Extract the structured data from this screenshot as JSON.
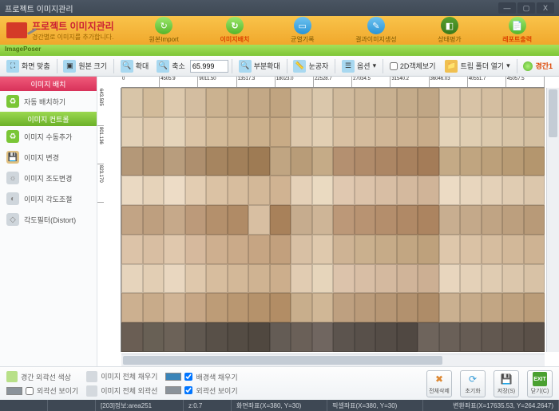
{
  "window": {
    "title": "프로젝트 이미지관리",
    "buttons": {
      "min": "—",
      "max": "▢",
      "close": "X"
    }
  },
  "header": {
    "title": "프로젝트 이미지관리",
    "subtitle": "경간별로 이미지를 추가합니다.",
    "steps": [
      {
        "label": "원본Import"
      },
      {
        "label": "이미지배치"
      },
      {
        "label": "균열기록"
      },
      {
        "label": "결과이미지생성"
      },
      {
        "label": "상태평가"
      },
      {
        "label": "레포트출력"
      }
    ]
  },
  "imageposer": {
    "label": "ImagePoser"
  },
  "toolbar": {
    "fit": "화면 맞춤",
    "orig": "원본 크기",
    "zoomin": "확대",
    "zoomout": "축소",
    "zoom_value": "65.999",
    "partzoom": "부분확대",
    "ruler": "눈공자",
    "options": "옵션",
    "box2d": "2D객체보기",
    "open": "트립 폴더 열기",
    "segment": "경간1"
  },
  "sidebar": {
    "hdr1": "이미지 배치",
    "items1": [
      {
        "label": "자동 배치하기"
      }
    ],
    "hdr2": "이미지 컨트롤",
    "items2": [
      {
        "label": "이미지 수동추가"
      },
      {
        "label": "이미지 변경"
      },
      {
        "label": "이미지 조도변경"
      },
      {
        "label": "이미지 각도조절"
      },
      {
        "label": "각도필터(Distort)"
      }
    ]
  },
  "ruler_top": [
    "0",
    "4505.9",
    "9011.50",
    "13517.3",
    "18023.0",
    "22528.7",
    "27034.5",
    "31540.2",
    "36046.03",
    "40551.7",
    "45057.5"
  ],
  "ruler_left": [
    "643.505",
    "801.136",
    "823.170"
  ],
  "cell_colors": [
    [
      "#d8c5a8",
      "#d2bb9a",
      "#ddc9ad",
      "#d3bda0",
      "#cbb290",
      "#c7ad8b",
      "#c3a886",
      "#c0a480",
      "#d5c0a3",
      "#dac7ab",
      "#d0ba9c",
      "#ccb596",
      "#c8b090",
      "#c4ab8a",
      "#c0a685",
      "#dcc8ac",
      "#d8c3a6",
      "#d4bea0",
      "#d0b99a",
      "#ccb494"
    ],
    [
      "#e2d0b6",
      "#dec9ad",
      "#e5d4ba",
      "#dbc4a6",
      "#d3ba98",
      "#cfb592",
      "#cbb08c",
      "#c8ab86",
      "#ddc8ac",
      "#e2cfb3",
      "#d8c0a2",
      "#d4bb9c",
      "#d0b696",
      "#ccb190",
      "#c8ac8a",
      "#e4d3b8",
      "#e0ceb2",
      "#dcc9ac",
      "#d8c4a6",
      "#d4bfa0"
    ],
    [
      "#b49878",
      "#b09372",
      "#b89d7d",
      "#ae8f6e",
      "#a68560",
      "#a2805a",
      "#9e7b54",
      "#c0a582",
      "#b89c78",
      "#c5ab87",
      "#b49070",
      "#b08b6a",
      "#ac8664",
      "#a8815e",
      "#a47c58",
      "#c4aa86",
      "#c0a580",
      "#bca07a",
      "#b89b74",
      "#b4966e"
    ],
    [
      "#ead9c2",
      "#e6d3ba",
      "#eddcc6",
      "#e3cdb2",
      "#dbc2a4",
      "#d7bd9e",
      "#d3b898",
      "#d0b392",
      "#e5d1b8",
      "#eadac1",
      "#e0c8b0",
      "#dcc3aa",
      "#d8bea4",
      "#d4b99e",
      "#d0b498",
      "#ecdbc4",
      "#e8d6be",
      "#e4d1b8",
      "#e0ccb2",
      "#dcc7ac"
    ],
    [
      "#c2a485",
      "#be9f7f",
      "#c6a98a",
      "#bc9a7a",
      "#b4906c",
      "#b08b66",
      "#d8bfa2",
      "#a8815a",
      "#c6ac8e",
      "#ceb597",
      "#bc9878",
      "#b89372",
      "#b48e6c",
      "#b08966",
      "#ac8460",
      "#c8ae90",
      "#c4a98a",
      "#c0a484",
      "#bc9f7e",
      "#b89a78"
    ],
    [
      "#dcc3a8",
      "#d8bea2",
      "#e0c8ad",
      "#d6b99d",
      "#ceaf8f",
      "#caaa89",
      "#c6a583",
      "#c2a07d",
      "#d8c0a4",
      "#dfc9ad",
      "#ceb394",
      "#cab08e",
      "#c6ab88",
      "#c2a682",
      "#bea17c",
      "#dec7ab",
      "#dac2a5",
      "#d6bd9f",
      "#d2b899",
      "#ceb393"
    ],
    [
      "#e6d4bc",
      "#e2ceb4",
      "#e9d7c0",
      "#dfc8ac",
      "#d7bd9e",
      "#d3b898",
      "#cfb392",
      "#ccae8c",
      "#e1ccb2",
      "#e6d5bb",
      "#dcc3ab",
      "#d8bea5",
      "#d4b99f",
      "#d0b499",
      "#ccaf93",
      "#e8d6be",
      "#e4d1b8",
      "#e0ccb2",
      "#dcc7ac",
      "#d8c2a6"
    ],
    [
      "#ccb090",
      "#c8ab8a",
      "#d0b495",
      "#c6a685",
      "#bd9c77",
      "#b99771",
      "#b5926b",
      "#b28d65",
      "#c8ae8c",
      "#d0b796",
      "#beA080",
      "#ba9b7a",
      "#b69674",
      "#b2916e",
      "#ae8c68",
      "#cab090",
      "#c6ab8a",
      "#c2a684",
      "#bea17e",
      "#ba9c78"
    ],
    [
      "#6a5e54",
      "#686055",
      "#6c6258",
      "#605850",
      "#585048",
      "#544c44",
      "#504840",
      "#645c55",
      "#6a6058",
      "#706660",
      "#5c544e",
      "#58504a",
      "#544c46",
      "#504842",
      "#6e645c",
      "#6a6058",
      "#665c54",
      "#625850",
      "#5e544c",
      "#5a5048"
    ]
  ],
  "options": {
    "outline_color": "경간 외곽선 색상",
    "show_outline": "외곽선 보이기",
    "fill_all": "이미지 전체 채우기",
    "outline_all": "이미지 전체 외곽선",
    "bg_fill": "배경색 채우기",
    "show_outline2": "외곽선 보이기",
    "buttons": {
      "delete_all": "전체삭제",
      "reset": "초기화",
      "save": "저장(S)",
      "close": "닫기(C)"
    }
  },
  "status": {
    "cell1": "[203]정보:area251",
    "cell2": "z:0.7",
    "cell3": "화면좌표(X=380, Y=30)",
    "cell4": "픽셀좌표(X=380, Y=30)",
    "cell5": "변환좌표(X=17635.53, Y=264.2647)"
  }
}
